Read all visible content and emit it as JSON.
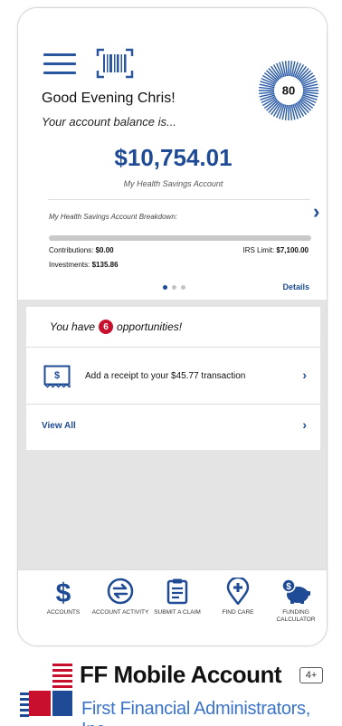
{
  "header": {
    "greeting": "Good Evening Chris!",
    "balance_prompt": "Your account balance is...",
    "score": "80"
  },
  "account": {
    "balance": "$10,754.01",
    "name": "My Health Savings Account",
    "breakdown_label": "My Health Savings Account Breakdown:",
    "contributions_label": "Contributions:",
    "contributions_value": "$0.00",
    "irs_limit_label": "IRS Limit:",
    "irs_limit_value": "$7,100.00",
    "investments_label": "Investments:",
    "investments_value": "$135.86",
    "contribution_progress": 0.0,
    "details_label": "Details"
  },
  "carousel": {
    "page_count": 3,
    "active_index": 0
  },
  "opportunities": {
    "prefix": "You have",
    "count": "6",
    "suffix": "opportunities!",
    "items": [
      {
        "label": "Add a receipt to your $45.77 transaction",
        "icon": "receipt-icon"
      }
    ],
    "view_all": "View All"
  },
  "tabbar": {
    "items": [
      {
        "label": "Accounts",
        "icon": "dollar-icon"
      },
      {
        "label": "Account Activity",
        "icon": "exchange-icon"
      },
      {
        "label": "Submit a Claim",
        "icon": "clipboard-icon"
      },
      {
        "label": "Find Care",
        "icon": "location-plus-icon"
      },
      {
        "label": "Funding Calculator",
        "icon": "piggy-bank-icon"
      }
    ]
  },
  "store": {
    "app_name": "FF Mobile Account",
    "age_rating": "4+",
    "company": "First Financial Administrators, Inc."
  },
  "colors": {
    "primary": "#1f4b96",
    "badge": "#c8102e",
    "link": "#3a73c9"
  }
}
